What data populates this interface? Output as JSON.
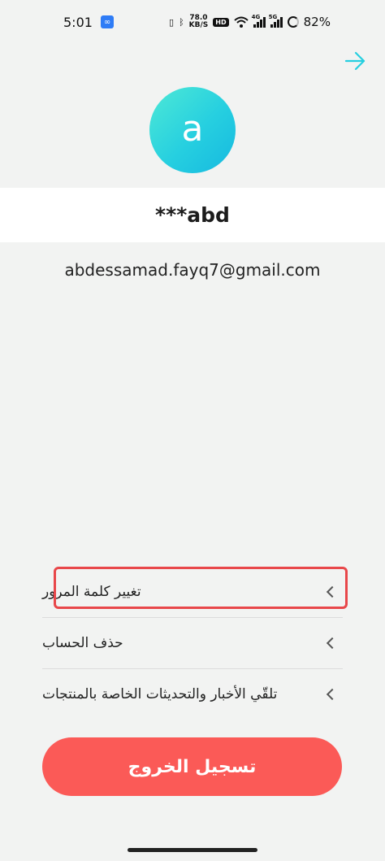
{
  "status_bar": {
    "time": "5:01",
    "speed_value": "78.0",
    "speed_unit": "KB/S",
    "hd_badge": "HD",
    "network_tag_1": "4G",
    "network_tag_2": "5G",
    "battery": "82%"
  },
  "profile": {
    "avatar_letter": "a",
    "username": "***abd",
    "email": "abdessamad.fayq7@gmail.com"
  },
  "menu": {
    "items": [
      {
        "label": "تغيير كلمة المرور"
      },
      {
        "label": "حذف الحساب"
      },
      {
        "label": "تلقّي الأخبار والتحديثات الخاصة بالمنتجات"
      }
    ]
  },
  "logout": {
    "label": "تسجيل الخروج"
  },
  "colors": {
    "accent": "#26cfe0",
    "logout": "#fb5a57",
    "highlight": "#e8474a",
    "background": "#f2f3f2"
  },
  "icons": {
    "forward": "arrow-right-icon",
    "chevron": "chevron-left-icon"
  }
}
